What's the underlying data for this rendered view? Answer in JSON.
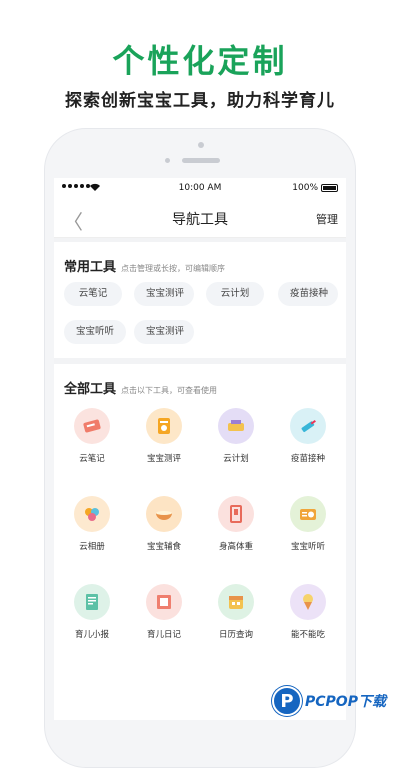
{
  "promo": {
    "headline": "个性化定制",
    "subline": "探索创新宝宝工具，助力科学育儿"
  },
  "statusbar": {
    "time": "10:00 AM",
    "battery": "100%"
  },
  "navbar": {
    "back_glyph": "〈",
    "title": "导航工具",
    "manage": "管理"
  },
  "common_tools": {
    "title": "常用工具",
    "hint": "点击管理或长按，可编辑顺序",
    "chips": [
      "云笔记",
      "宝宝测评",
      "云计划",
      "疫苗接种",
      "宝宝听听",
      "宝宝测评"
    ]
  },
  "all_tools": {
    "title": "全部工具",
    "hint": "点击以下工具，可查看使用",
    "items": [
      {
        "label": "云笔记",
        "icon": "cloud-notes-icon",
        "color": "#fbe3df"
      },
      {
        "label": "宝宝测评",
        "icon": "baby-assessment-icon",
        "color": "#fde7c8"
      },
      {
        "label": "云计划",
        "icon": "cloud-plan-icon",
        "color": "#e4ddf6"
      },
      {
        "label": "疫苗接种",
        "icon": "vaccine-icon",
        "color": "#d9f1f6"
      },
      {
        "label": "云相册",
        "icon": "cloud-album-icon",
        "color": "#fde9cf"
      },
      {
        "label": "宝宝辅食",
        "icon": "baby-food-icon",
        "color": "#fde4c4"
      },
      {
        "label": "身高体重",
        "icon": "height-weight-icon",
        "color": "#fbe1de"
      },
      {
        "label": "宝宝听听",
        "icon": "radio-icon",
        "color": "#e4f2d8"
      },
      {
        "label": "育儿小报",
        "icon": "parenting-news-icon",
        "color": "#def2e8"
      },
      {
        "label": "育儿日记",
        "icon": "parenting-diary-icon",
        "color": "#fbe1de"
      },
      {
        "label": "日历查询",
        "icon": "calendar-icon",
        "color": "#def2e4"
      },
      {
        "label": "能不能吃",
        "icon": "ice-cream-icon",
        "color": "#ece2f7"
      }
    ]
  },
  "watermark": {
    "logo_letter": "P",
    "text": "PCPOP下载"
  },
  "colors": {
    "accent_green": "#1aa35a",
    "brand_blue": "#1565c0"
  }
}
